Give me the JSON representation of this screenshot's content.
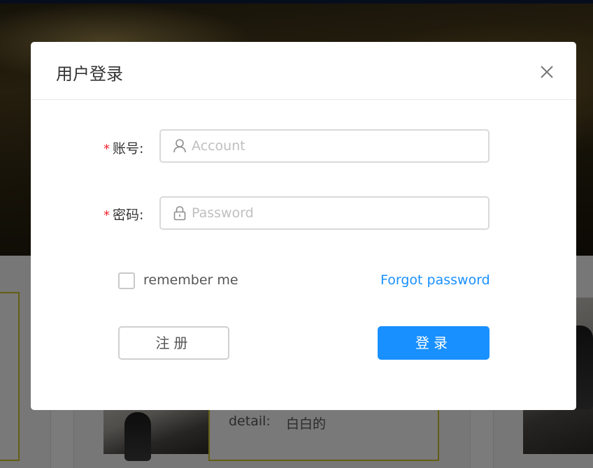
{
  "background": {
    "card_detail_label": "detail:",
    "card_detail_value": "白白的"
  },
  "modal": {
    "title": "用户登录",
    "close_icon": "close-icon",
    "account": {
      "required_mark": "*",
      "label": "账号:",
      "icon": "user-icon",
      "placeholder": "Account",
      "value": ""
    },
    "password": {
      "required_mark": "*",
      "label": "密码:",
      "icon": "lock-icon",
      "placeholder": "Password",
      "value": ""
    },
    "remember_label": "remember me",
    "remember_checked": false,
    "forgot_label": "Forgot password",
    "register_label": "注册",
    "login_label": "登录"
  },
  "colors": {
    "primary": "#1890ff",
    "required": "#f5222d",
    "card_border": "#c8bd2c"
  }
}
